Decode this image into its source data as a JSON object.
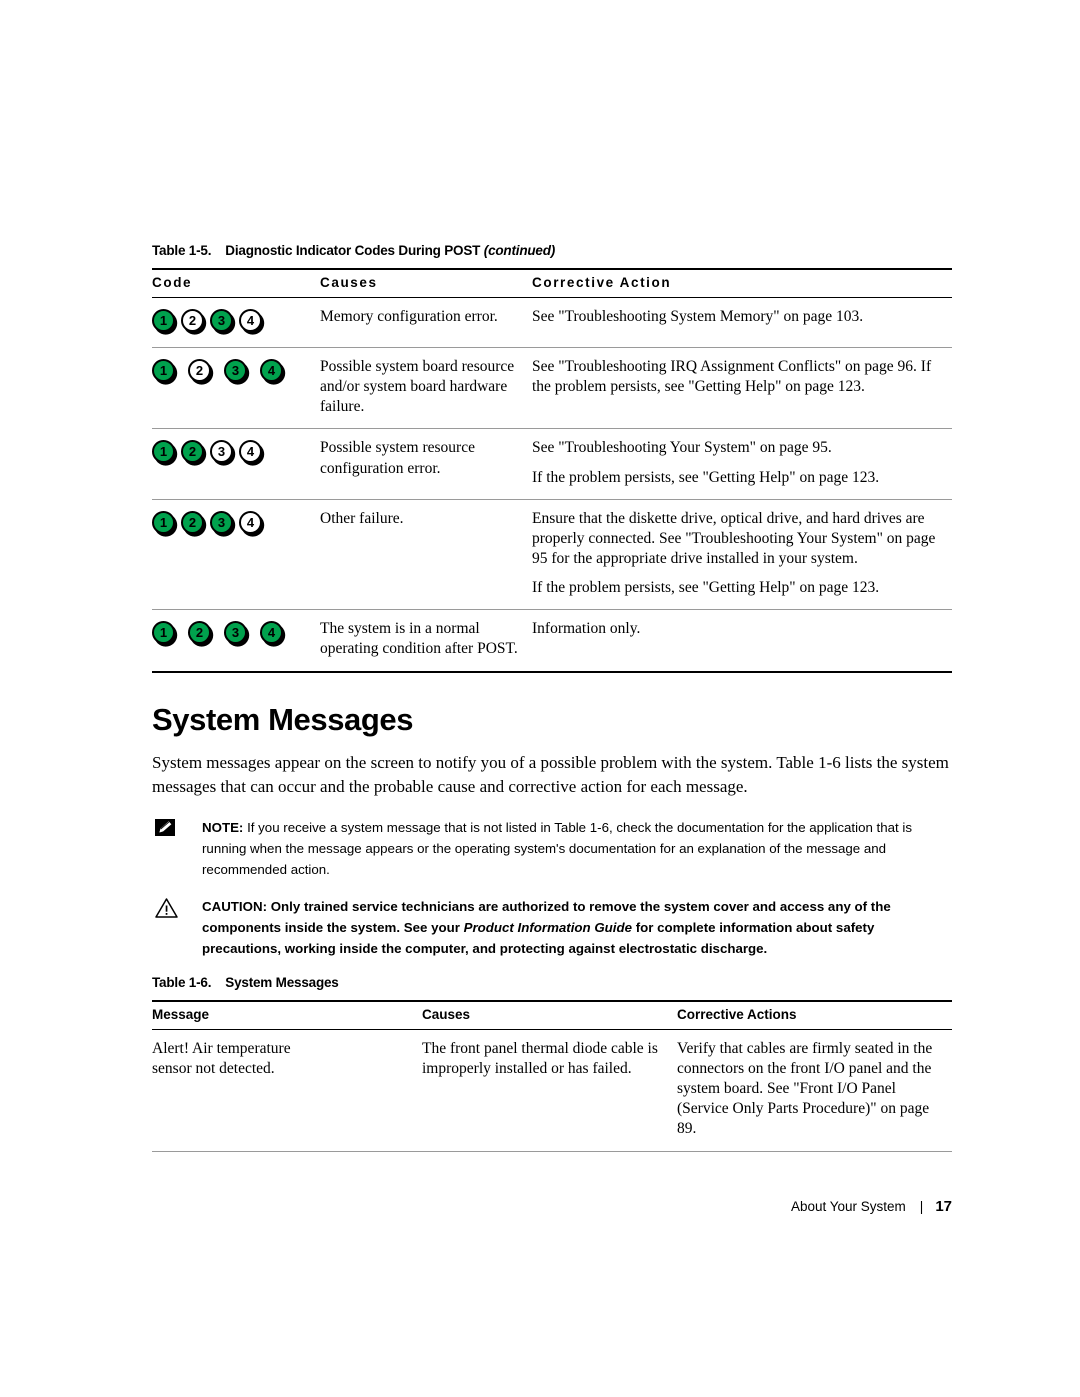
{
  "table_1_5": {
    "caption_number": "Table 1-5.",
    "caption_title": "Diagnostic Indicator Codes During POST",
    "caption_continued": "(continued)",
    "headers": {
      "code": "Code",
      "causes": "Causes",
      "action": "Corrective Action"
    },
    "rows": [
      {
        "lamps": [
          {
            "label": "1",
            "state": "on"
          },
          {
            "label": "2",
            "state": "off"
          },
          {
            "label": "3",
            "state": "on"
          },
          {
            "label": "4",
            "state": "off"
          }
        ],
        "lamp_spacing": "tight",
        "cause": "Memory configuration error.",
        "action_paragraphs": [
          "See \"Troubleshooting System Memory\" on page 103."
        ]
      },
      {
        "lamps": [
          {
            "label": "1",
            "state": "on"
          },
          {
            "label": "2",
            "state": "off"
          },
          {
            "label": "3",
            "state": "on"
          },
          {
            "label": "4",
            "state": "on"
          }
        ],
        "lamp_spacing": "wide",
        "cause": "Possible system board resource and/or system board hardware failure.",
        "action_paragraphs": [
          "See \"Troubleshooting IRQ Assignment Conflicts\" on page 96. If the problem persists, see \"Getting Help\" on page 123."
        ]
      },
      {
        "lamps": [
          {
            "label": "1",
            "state": "on"
          },
          {
            "label": "2",
            "state": "on"
          },
          {
            "label": "3",
            "state": "off"
          },
          {
            "label": "4",
            "state": "off"
          }
        ],
        "lamp_spacing": "tight",
        "cause": "Possible system resource configuration error.",
        "action_paragraphs": [
          "See \"Troubleshooting Your System\" on page 95.",
          "If the problem persists, see \"Getting Help\" on page 123."
        ]
      },
      {
        "lamps": [
          {
            "label": "1",
            "state": "on"
          },
          {
            "label": "2",
            "state": "on"
          },
          {
            "label": "3",
            "state": "on"
          },
          {
            "label": "4",
            "state": "off"
          }
        ],
        "lamp_spacing": "tight",
        "cause": "Other failure.",
        "action_paragraphs": [
          "Ensure that the diskette drive, optical drive, and hard drives are properly connected. See \"Troubleshooting Your System\" on page 95 for the appropriate drive installed in your system.",
          "If the problem persists, see \"Getting Help\" on page 123."
        ]
      },
      {
        "lamps": [
          {
            "label": "1",
            "state": "on"
          },
          {
            "label": "2",
            "state": "on"
          },
          {
            "label": "3",
            "state": "on"
          },
          {
            "label": "4",
            "state": "on"
          }
        ],
        "lamp_spacing": "wide",
        "cause": "The system is in a normal operating condition after POST.",
        "action_paragraphs": [
          "Information only."
        ]
      }
    ]
  },
  "section": {
    "heading": "System Messages",
    "paragraph": "System messages appear on the screen to notify you of a possible problem with the system. Table 1-6 lists the system messages that can occur and the probable cause and corrective action for each message."
  },
  "note": {
    "icon": "note-pencil-icon",
    "lead": "NOTE:",
    "text": " If you receive a system message that is not listed in Table 1-6, check the documentation for the application that is running when the message appears or the operating system's documentation for an explanation of the message and recommended action."
  },
  "caution": {
    "icon": "warning-triangle-icon",
    "lead": "CAUTION:",
    "text_before": " Only trained service technicians are authorized to remove the system cover and access any of the components inside the system. See your ",
    "italic_title": "Product Information Guide",
    "text_after": " for complete information about safety precautions, working inside the computer, and protecting against electrostatic discharge."
  },
  "table_1_6": {
    "caption_number": "Table 1-6.",
    "caption_title": "System Messages",
    "headers": {
      "message": "Message",
      "causes": "Causes",
      "actions": "Corrective Actions"
    },
    "rows": [
      {
        "message": "Alert! Air temperature\nsensor not detected.",
        "cause": "The front panel thermal diode cable is improperly installed or has failed.",
        "action": "Verify that cables are firmly seated in the connectors on the front I/O panel and the system board. See \"Front I/O Panel (Service Only Parts Procedure)\" on page 89."
      }
    ]
  },
  "footer": {
    "section_name": "About Your System",
    "separator": "|",
    "page_number": "17"
  },
  "colors": {
    "indicator_on": "#00a24d",
    "indicator_off": "#ffffff",
    "rule": "#000000"
  }
}
